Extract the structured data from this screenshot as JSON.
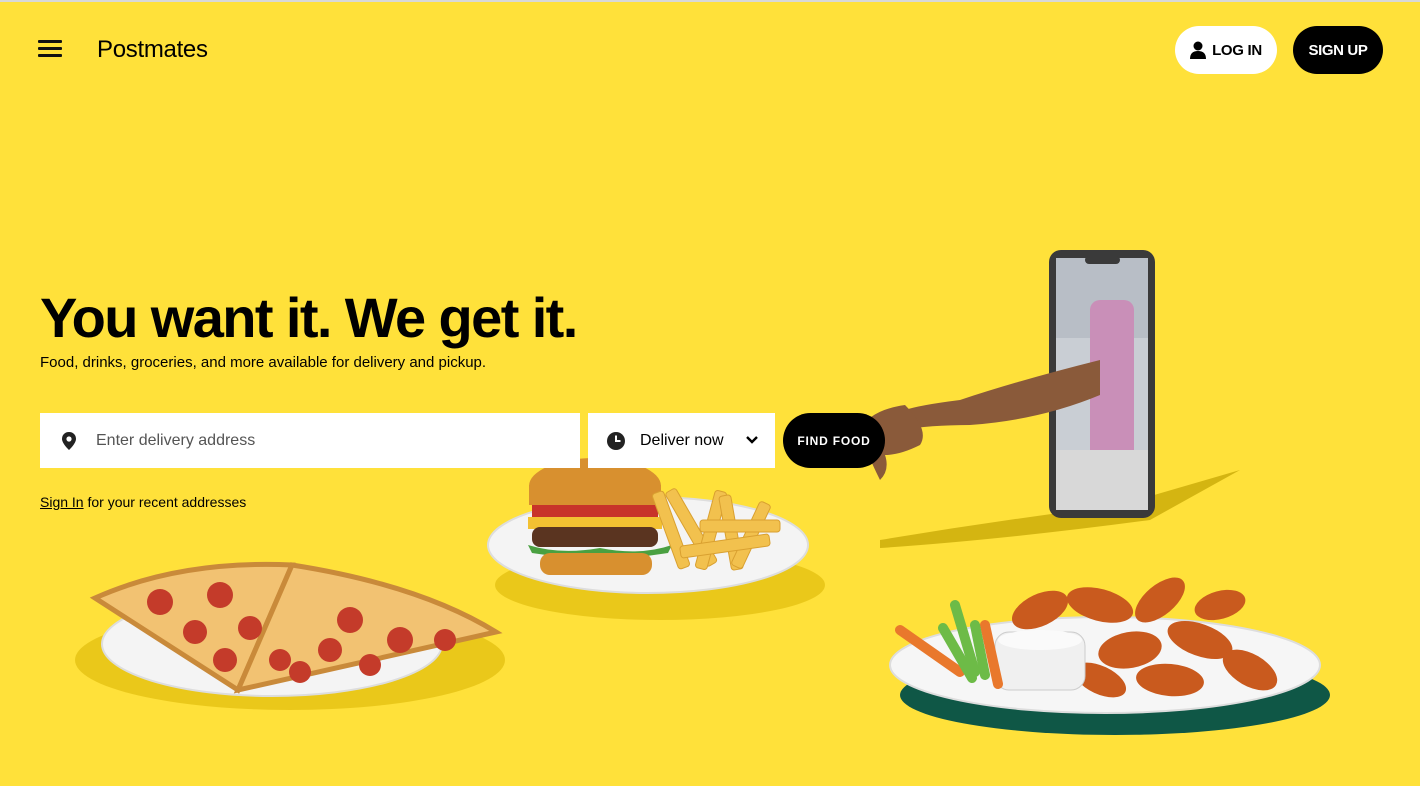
{
  "header": {
    "logo": "Postmates",
    "login_label": "LOG IN",
    "signup_label": "SIGN UP"
  },
  "hero": {
    "headline": "You want it. We get it.",
    "subheadline": "Food, drinks, groceries, and more available for delivery and pickup.",
    "address_placeholder": "Enter delivery address",
    "deliver_time": "Deliver now",
    "find_button": "FIND FOOD",
    "signin_link": "Sign In",
    "signin_suffix": " for your recent addresses"
  },
  "colors": {
    "background": "#ffe13a",
    "primary": "#000000",
    "surface": "#ffffff"
  },
  "icons": [
    "menu-icon",
    "user-icon",
    "location-pin-icon",
    "clock-icon",
    "chevron-down-icon"
  ]
}
